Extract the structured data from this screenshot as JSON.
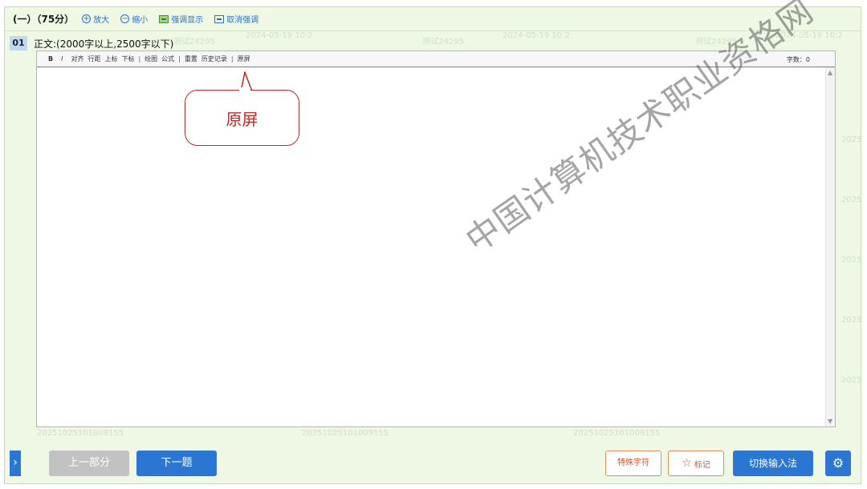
{
  "header": {
    "section_title": "(一）（75分）",
    "zoom_in_label": "放大",
    "zoom_out_label": "缩小",
    "highlight_show_label": "强调显示",
    "cancel_highlight_label": "取消强调"
  },
  "question": {
    "number": "01",
    "text": "正文:(2000字以上,2500字以下)"
  },
  "editor": {
    "toolbar": {
      "bold": "B",
      "italic": "I",
      "align": "对齐",
      "line_spacing": "行距",
      "superscript": "上标",
      "subscript": "下标",
      "draw": "绘图",
      "formula": "公式",
      "reset": "重置",
      "history": "历史记录",
      "original_screen": "原屏"
    },
    "word_count": "字数：0"
  },
  "callout": {
    "text": "原屏"
  },
  "watermark": {
    "main": "中国计算机技术职业资格网",
    "minor": [
      "测试24295",
      "2024-05-19 10:2",
      "20251025101009155",
      "2025"
    ]
  },
  "footer": {
    "expand_icon": "›",
    "prev_label": "上一部分",
    "next_label": "下一题",
    "special_chars_label": "特殊字符",
    "mark_label": "标记",
    "switch_ime_label": "切换输入法"
  },
  "colors": {
    "primary": "#2a76d2",
    "disabled": "#c2c2c2",
    "accent": "#d4542c",
    "callout": "#b72a2a",
    "background": "#eef8e4"
  }
}
